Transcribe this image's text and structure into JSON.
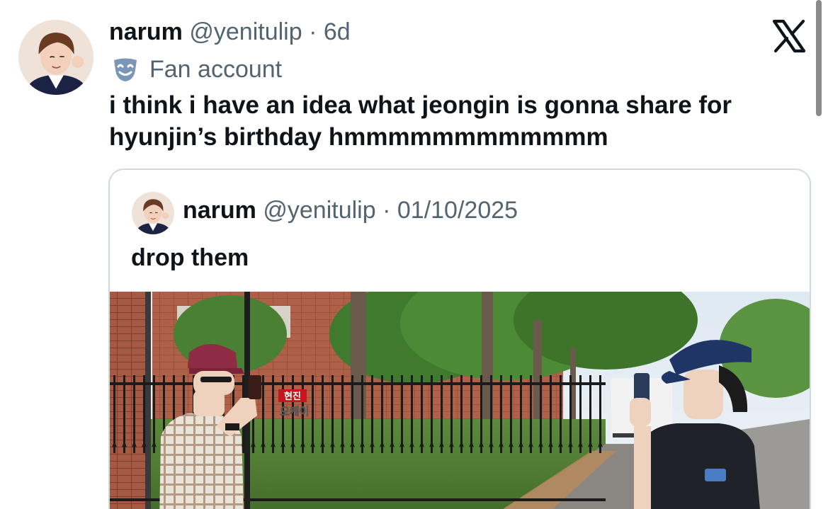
{
  "tweet": {
    "author": {
      "name": "narum",
      "handle": "@yenitulip"
    },
    "separator": "·",
    "time": "6d",
    "label": {
      "icon": "theater-mask-icon",
      "text": "Fan account"
    },
    "text": "i think i have an idea what jeongin is gonna share for\nhyunjin’s birthday hmmmmmmmmmmmm"
  },
  "brand": {
    "icon": "x-logo-icon"
  },
  "quote": {
    "author": {
      "name": "narum",
      "handle": "@yenitulip"
    },
    "separator": "·",
    "date": "01/10/2025",
    "text": "drop them",
    "media": {
      "caption_name": "현진",
      "caption_text": "오케이"
    }
  },
  "colors": {
    "text_primary": "#0f1419",
    "text_secondary": "#536471",
    "border": "#cfd9de",
    "fan_icon": "#7a97b8"
  }
}
